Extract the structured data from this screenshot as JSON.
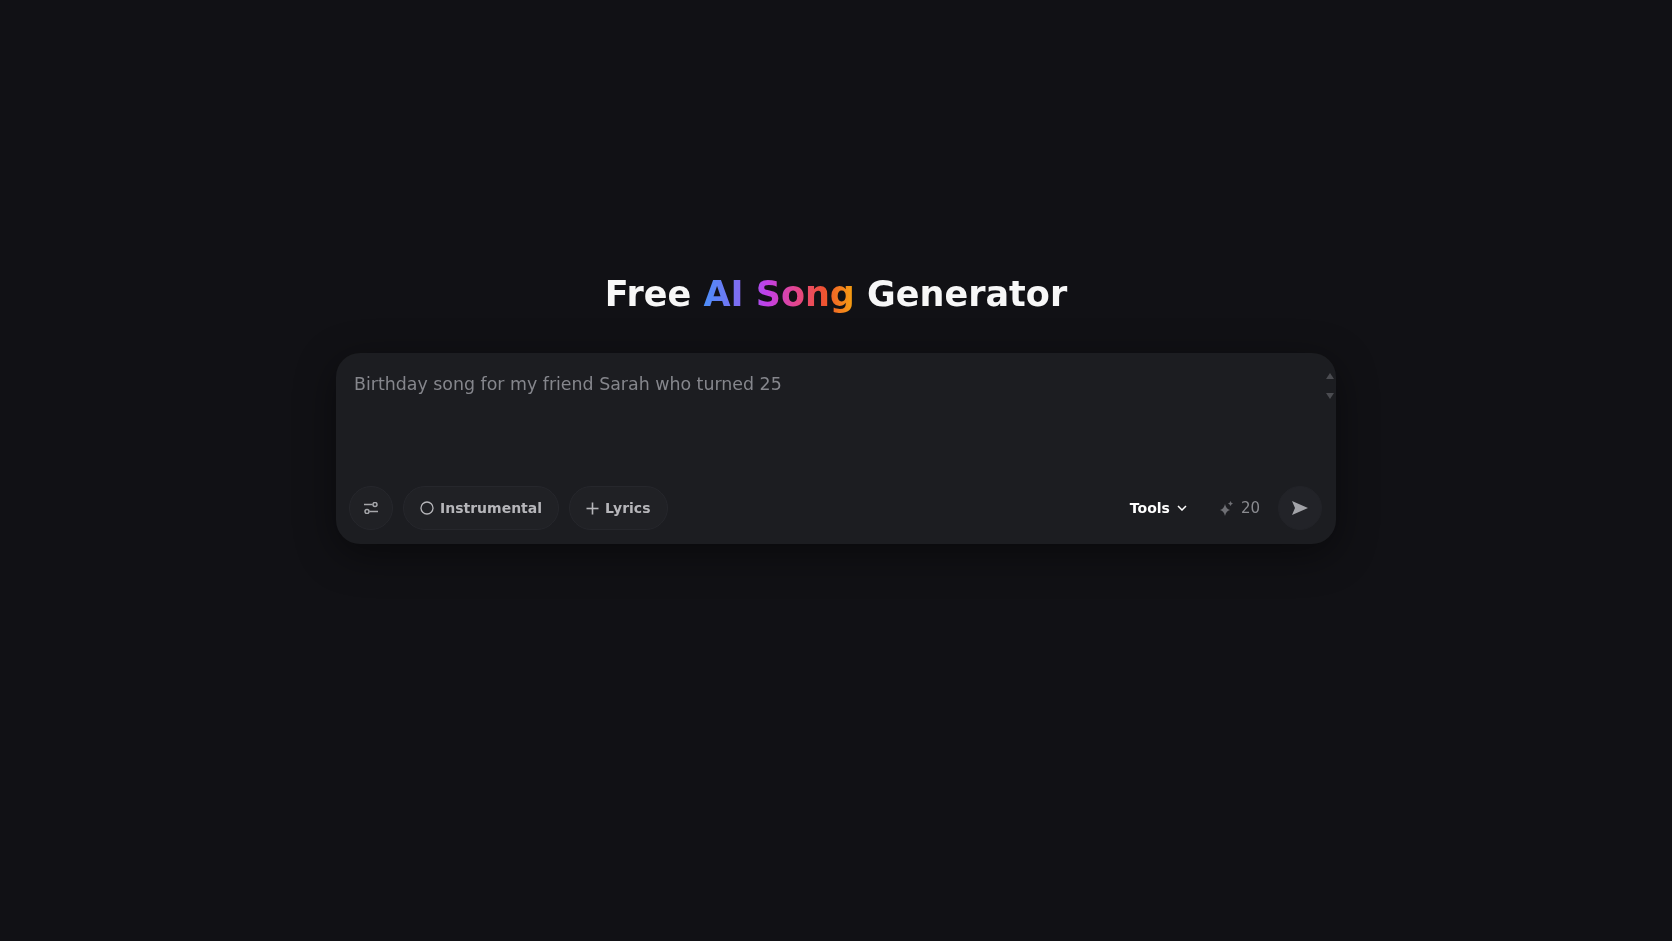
{
  "title": {
    "parts": [
      {
        "text": "Free ",
        "kind": "plain"
      },
      {
        "text": "AI Song",
        "kind": "gradient"
      },
      {
        "text": " Generator",
        "kind": "plain"
      }
    ]
  },
  "prompt": {
    "placeholder": "Birthday song for my friend Sarah who turned 25"
  },
  "toolbar": {
    "instrumental": {
      "label": "Instrumental",
      "checked": false
    },
    "lyrics": {
      "label": "Lyrics"
    },
    "tools": {
      "label": "Tools"
    },
    "credits": "20"
  }
}
